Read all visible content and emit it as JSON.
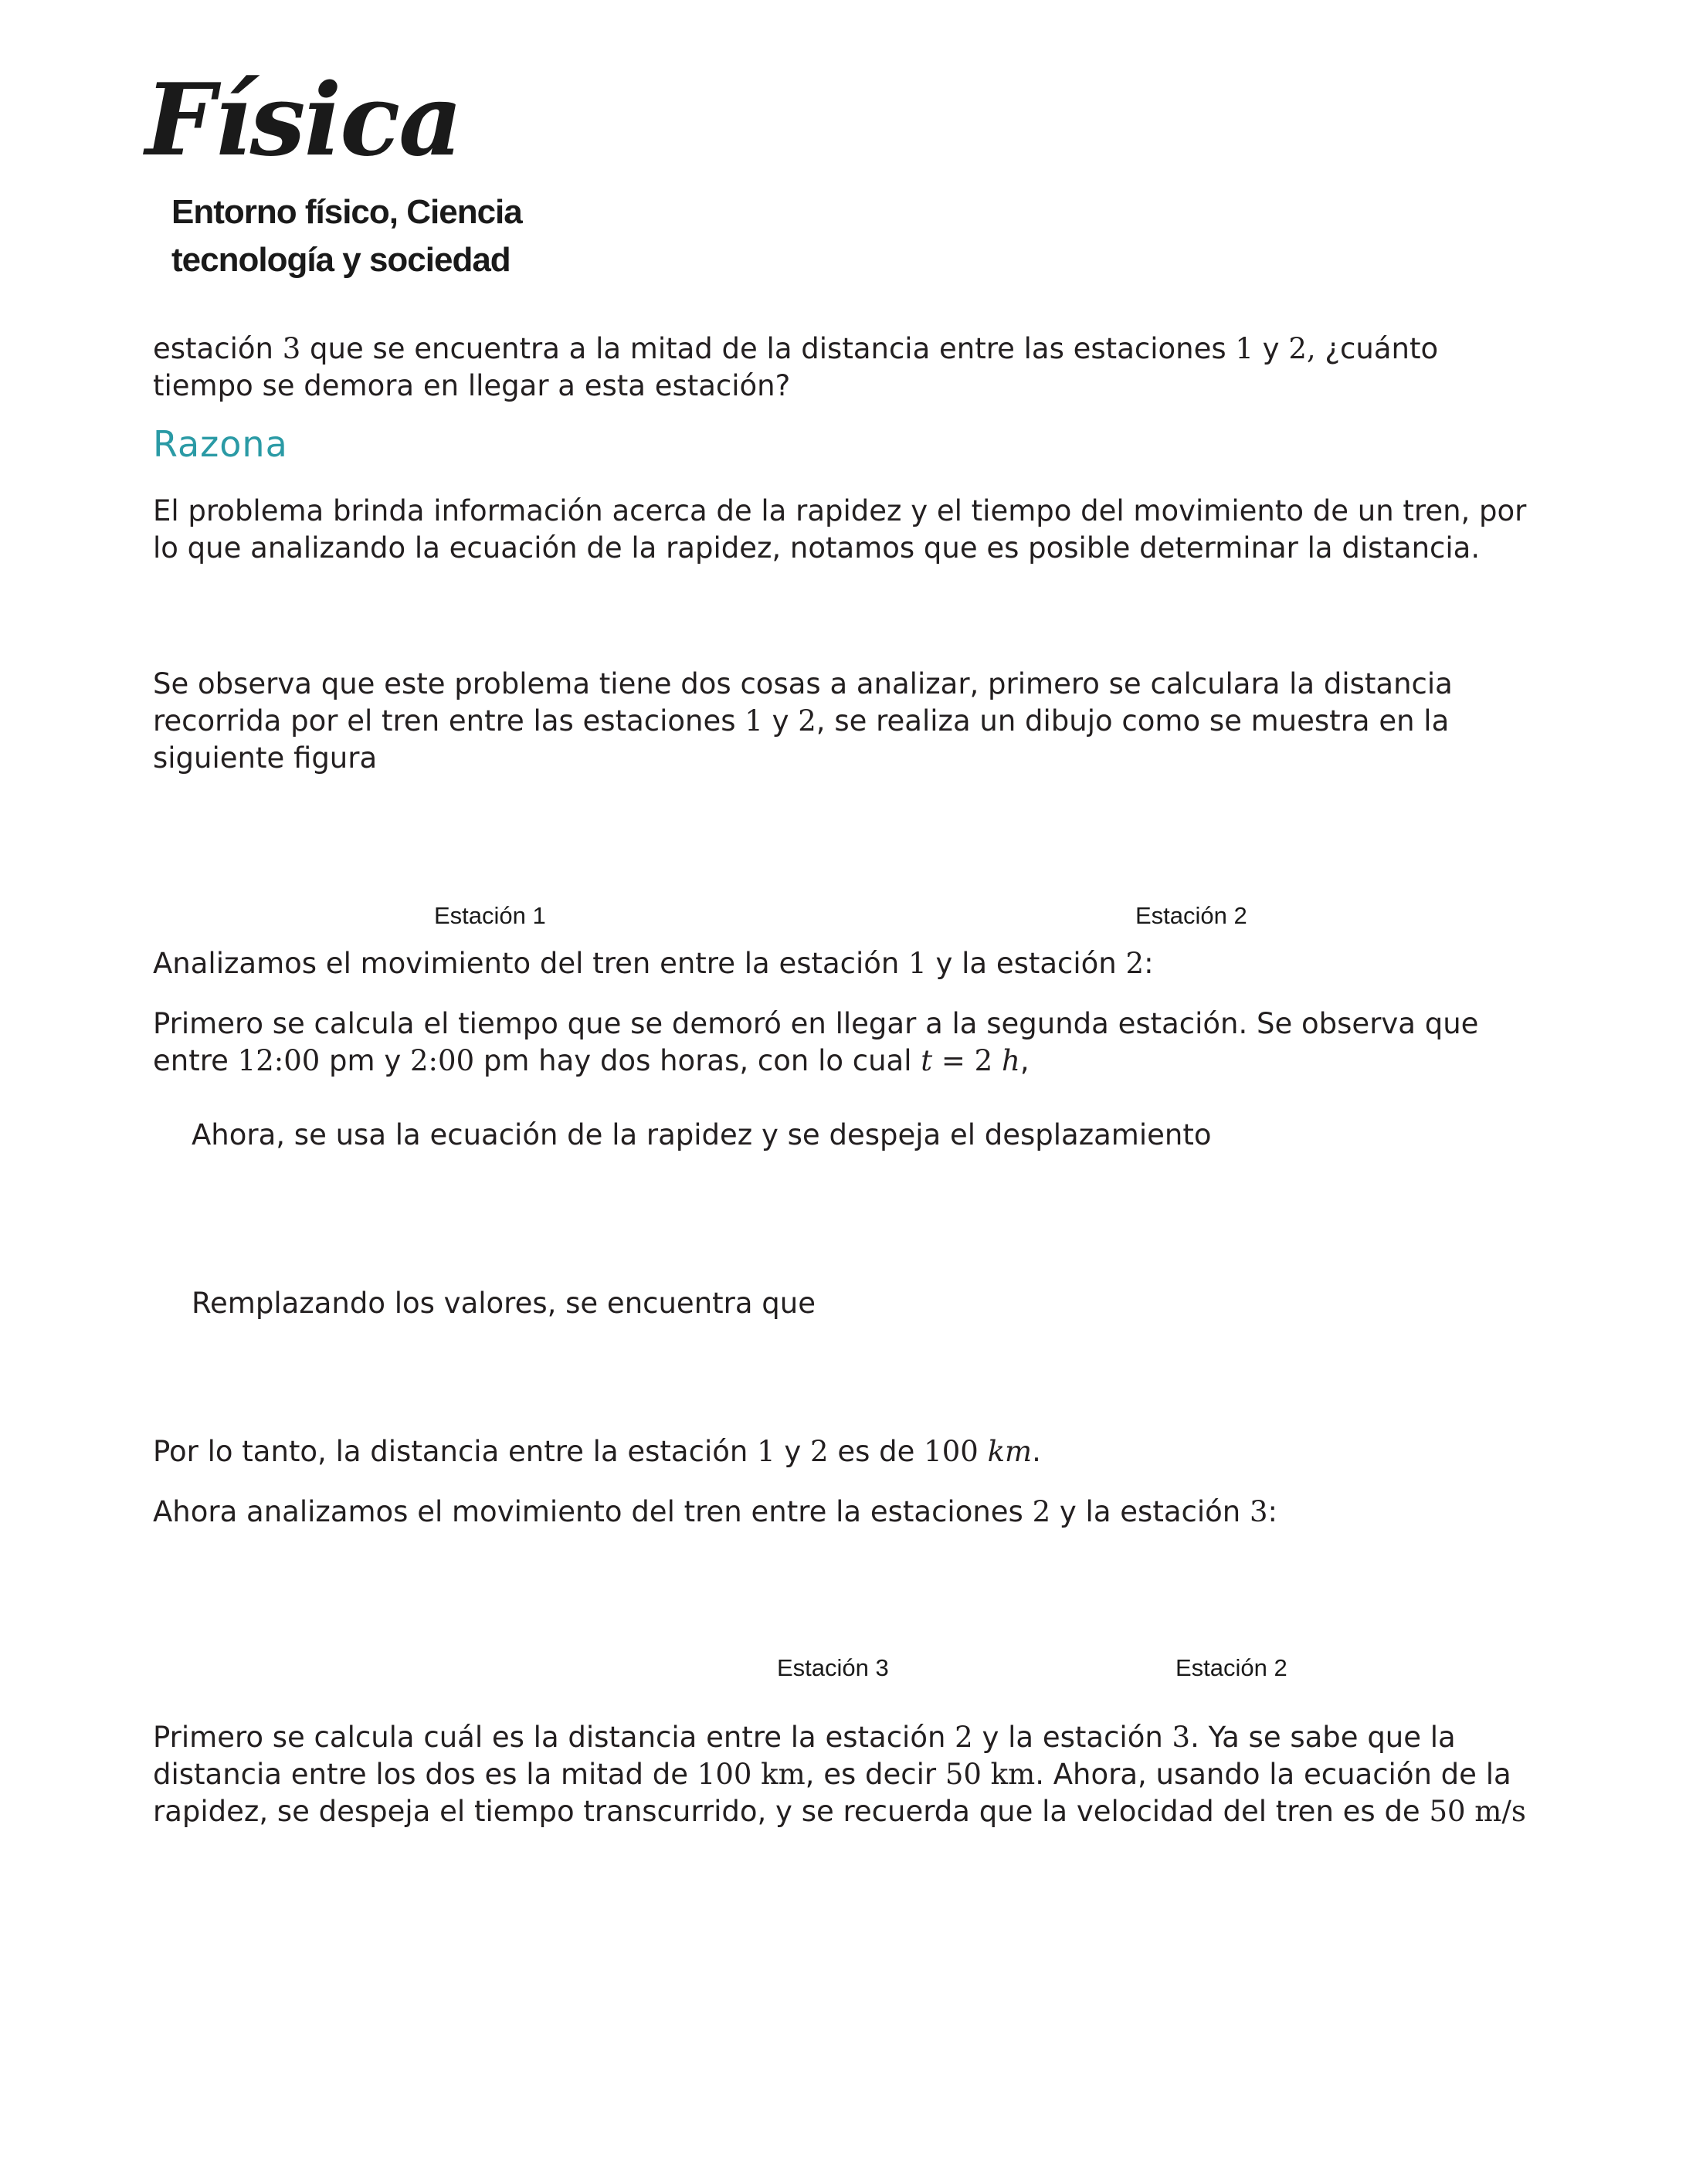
{
  "header": {
    "title": "Física",
    "subtitle_line1": "Entorno físico, Ciencia",
    "subtitle_line2": "tecnología y sociedad"
  },
  "content": {
    "p1": {
      "a": "estación ",
      "n1": "3",
      "b": " que se encuentra a la mitad de la distancia entre las estaciones ",
      "n2": "1",
      "c": " y ",
      "n3": "2,",
      "d": " ¿cuánto tiempo se demora en llegar a esta estación?"
    },
    "heading": "Razona",
    "p2": "El problema brinda información acerca de la rapidez y el tiempo del movimiento de un tren, por lo que analizando la ecuación de la rapidez, notamos que es posible determinar la distancia.",
    "p3": {
      "a": "Se observa que este problema tiene dos cosas a analizar, primero se calculara la distancia recorrida por el tren entre las estaciones ",
      "n1": "1",
      "b": " y ",
      "n2": "2",
      "c": ", se realiza un dibujo como se muestra en la siguiente figura"
    },
    "figure1": {
      "label_left": "Estación 1",
      "label_right": "Estación 2"
    },
    "p4": {
      "a": "Analizamos el movimiento del tren entre la estación ",
      "n1": "1",
      "b": " y la estación ",
      "n2": "2",
      "c": ":"
    },
    "p5": {
      "a": "Primero se calcula el tiempo que se demoró en llegar a la segunda estación. Se observa que entre ",
      "t1": "12:00",
      "b": " pm y ",
      "t2": "2:00",
      "c": " pm hay dos horas, con lo cual ",
      "eq_var": "t",
      "eq_rest": " = 2 ",
      "eq_unit": "h",
      "d": ","
    },
    "p6": "Ahora, se usa la ecuación de la rapidez y se despeja el desplazamiento",
    "p7": "Remplazando los valores, se encuentra que",
    "p8": {
      "a": "Por lo tanto, la distancia entre la estación ",
      "n1": "1",
      "b": " y ",
      "n2": "2",
      "c": " es de ",
      "val": "100 ",
      "unit": "km",
      "d": "."
    },
    "p9": {
      "a": "Ahora analizamos el movimiento del tren entre la estaciones ",
      "n1": "2",
      "b": " y la estación ",
      "n2": "3",
      "c": ":"
    },
    "figure2": {
      "label_left": "Estación 3",
      "label_right": "Estación 2"
    },
    "p10": {
      "a": "Primero se calcula cuál es la distancia entre la estación ",
      "n1": "2",
      "b": " y la estación ",
      "n2": "3",
      "c": ". Ya se sabe que la distancia entre los dos es la mitad de ",
      "v1": "100 km",
      "d": ", es decir ",
      "v2": "50 km",
      "e": ". Ahora, usando la ecuación de la rapidez, se despeja el tiempo transcurrido, y se recuerda que la velocidad del tren es de ",
      "v3": "50 m/s"
    }
  }
}
